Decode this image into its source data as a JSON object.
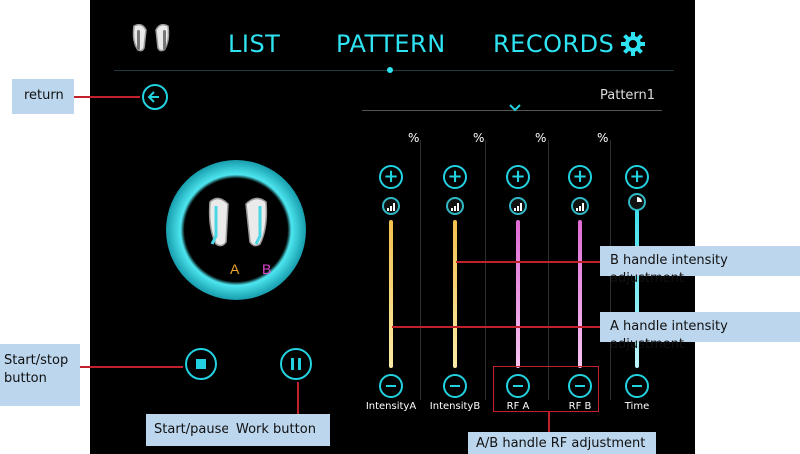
{
  "nav": {
    "list": "LIST",
    "pattern": "PATTERN",
    "records": "RECORDS"
  },
  "pattern_name": "Pattern1",
  "handles": {
    "a": "A",
    "b": "B"
  },
  "columns": [
    {
      "label": "IntensityA",
      "unit": "%",
      "color": "#f2c14e"
    },
    {
      "label": "IntensityB",
      "unit": "%",
      "color": "#f2c14e"
    },
    {
      "label": "RF A",
      "unit": "%",
      "color": "#e06bd6"
    },
    {
      "label": "RF B",
      "unit": "%",
      "color": "#e06bd6"
    },
    {
      "label": "Time",
      "unit": "",
      "color": "#3fe0ec"
    }
  ],
  "callouts": {
    "return": "return",
    "start_stop": "Start/stop\nbutton",
    "start_pause": "Start/pause",
    "work_button": "Work button",
    "b_intensity": "B handle intensity adjustment",
    "a_intensity": "A handle intensity adjustment",
    "rf_adjust": "A/B handle RF adjustment"
  },
  "colors": {
    "accent": "#23d2e0",
    "a_label": "#f2a531",
    "b_label": "#e04ad6",
    "callout_bg": "#bcd6ee",
    "callout_line": "#c0212a"
  }
}
